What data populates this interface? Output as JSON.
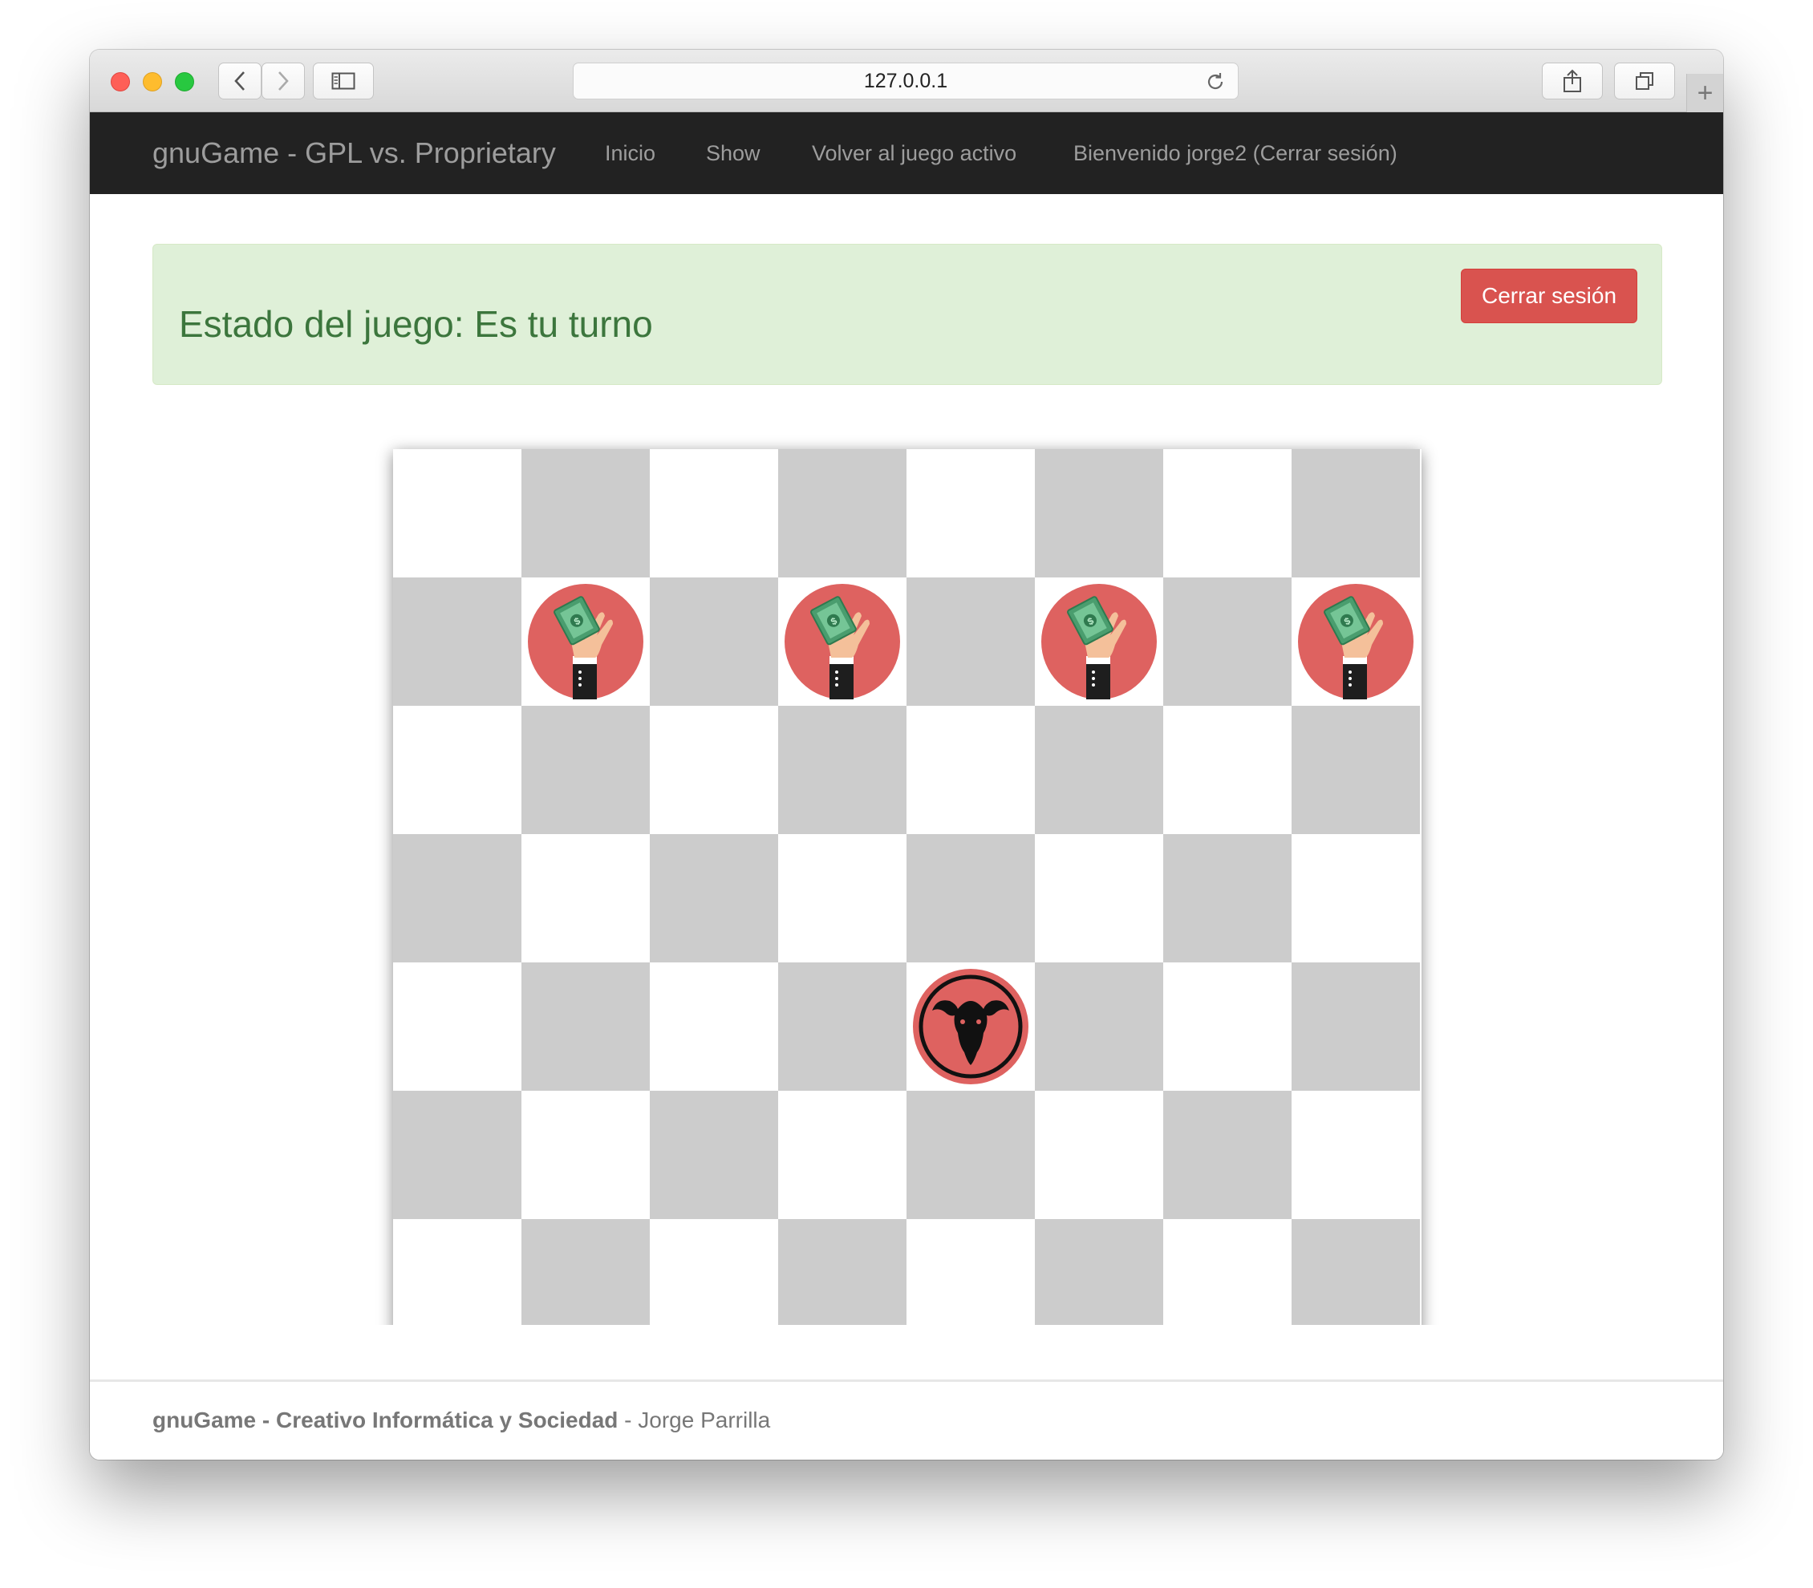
{
  "browser": {
    "url": "127.0.0.1",
    "icons": [
      "back-icon",
      "forward-icon",
      "sidebar-icon",
      "reload-icon",
      "share-icon",
      "tabs-icon",
      "plus-icon"
    ],
    "new_tab": "+"
  },
  "navbar": {
    "brand": "gnuGame - GPL vs. Proprietary",
    "links": [
      "Inicio",
      "Show",
      "Volver al juego activo",
      "Bienvenido jorge2 (Cerrar sesión)"
    ]
  },
  "alert": {
    "title": "Estado del juego: Es tu turno",
    "button": "Cerrar sesión",
    "bg_color": "#dff0d8",
    "text_color": "#3c763d",
    "button_color": "#d9534f"
  },
  "board": {
    "size": 8,
    "colors": {
      "light": "#ffffff",
      "dark": "#cccccc",
      "piece_bg": "#de6260"
    },
    "pieces": [
      {
        "type": "proprietary-hand-money",
        "row": 1,
        "col": 1
      },
      {
        "type": "proprietary-hand-money",
        "row": 1,
        "col": 3
      },
      {
        "type": "proprietary-hand-money",
        "row": 1,
        "col": 5
      },
      {
        "type": "proprietary-hand-money",
        "row": 1,
        "col": 7
      },
      {
        "type": "gnu-head",
        "row": 4,
        "col": 4
      }
    ]
  },
  "footer": {
    "bold": "gnuGame - Creativo Informática y Sociedad",
    "sep": " - ",
    "author": "Jorge Parrilla"
  }
}
